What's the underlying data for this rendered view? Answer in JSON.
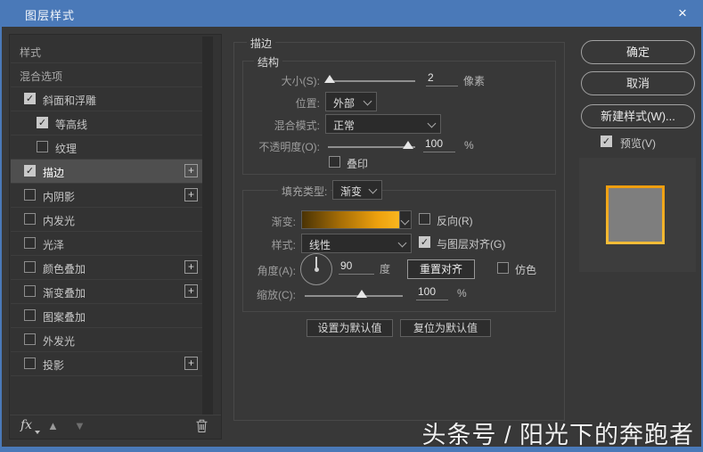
{
  "window": {
    "title": "图层样式",
    "close_icon": "×"
  },
  "sidebar": {
    "items": [
      {
        "key": "styles",
        "label": "样式",
        "type": "plain"
      },
      {
        "key": "blending-options",
        "label": "混合选项",
        "type": "plain"
      },
      {
        "key": "bevel-emboss",
        "label": "斜面和浮雕",
        "checkbox": true,
        "checked": true
      },
      {
        "key": "contour",
        "label": "等高线",
        "checkbox": true,
        "checked": true,
        "indent": true
      },
      {
        "key": "texture",
        "label": "纹理",
        "checkbox": true,
        "checked": false,
        "indent": true
      },
      {
        "key": "stroke",
        "label": "描边",
        "checkbox": true,
        "checked": true,
        "selected": true,
        "plus": true
      },
      {
        "key": "inner-shadow",
        "label": "内阴影",
        "checkbox": true,
        "checked": false,
        "plus": true
      },
      {
        "key": "inner-glow",
        "label": "内发光",
        "checkbox": true,
        "checked": false
      },
      {
        "key": "satin",
        "label": "光泽",
        "checkbox": true,
        "checked": false
      },
      {
        "key": "color-overlay",
        "label": "颜色叠加",
        "checkbox": true,
        "checked": false,
        "plus": true
      },
      {
        "key": "gradient-overlay",
        "label": "渐变叠加",
        "checkbox": true,
        "checked": false,
        "plus": true
      },
      {
        "key": "pattern-overlay",
        "label": "图案叠加",
        "checkbox": true,
        "checked": false
      },
      {
        "key": "outer-glow",
        "label": "外发光",
        "checkbox": true,
        "checked": false
      },
      {
        "key": "drop-shadow",
        "label": "投影",
        "checkbox": true,
        "checked": false,
        "plus": true
      }
    ],
    "footer": {
      "fx_label": "fx"
    }
  },
  "panel": {
    "heading": "描边",
    "structure": {
      "title": "结构",
      "size_label": "大小(S):",
      "size_value": "2",
      "size_unit": "像素",
      "position_label": "位置:",
      "position_value": "外部",
      "blend_label": "混合模式:",
      "blend_value": "正常",
      "opacity_label": "不透明度(O):",
      "opacity_value": "100",
      "opacity_unit": "%",
      "overprint_label": "叠印",
      "overprint_checked": false
    },
    "fill": {
      "type_label": "填充类型:",
      "type_value": "渐变",
      "gradient_label": "渐变:",
      "reverse_label": "反向(R)",
      "reverse_checked": false,
      "style_label": "样式:",
      "style_value": "线性",
      "align_label": "与图层对齐(G)",
      "align_checked": true,
      "angle_label": "角度(A):",
      "angle_value": "90",
      "angle_unit": "度",
      "reset_align_button": "重置对齐",
      "dither_label": "仿色",
      "dither_checked": false,
      "scale_label": "缩放(C):",
      "scale_value": "100",
      "scale_unit": "%"
    },
    "set_default_button": "设置为默认值",
    "reset_default_button": "复位为默认值"
  },
  "actions": {
    "ok": "确定",
    "cancel": "取消",
    "new_style": "新建样式(W)...",
    "preview_label": "预览(V)",
    "preview_checked": true
  },
  "watermark": "头条号 / 阳光下的奔跑者",
  "colors": {
    "titlebar": "#4a79b8",
    "gradient_start": "#4a3305",
    "gradient_end": "#f9b61f",
    "stroke_orange": "#ef9d0e"
  },
  "check_glyph": "✓"
}
